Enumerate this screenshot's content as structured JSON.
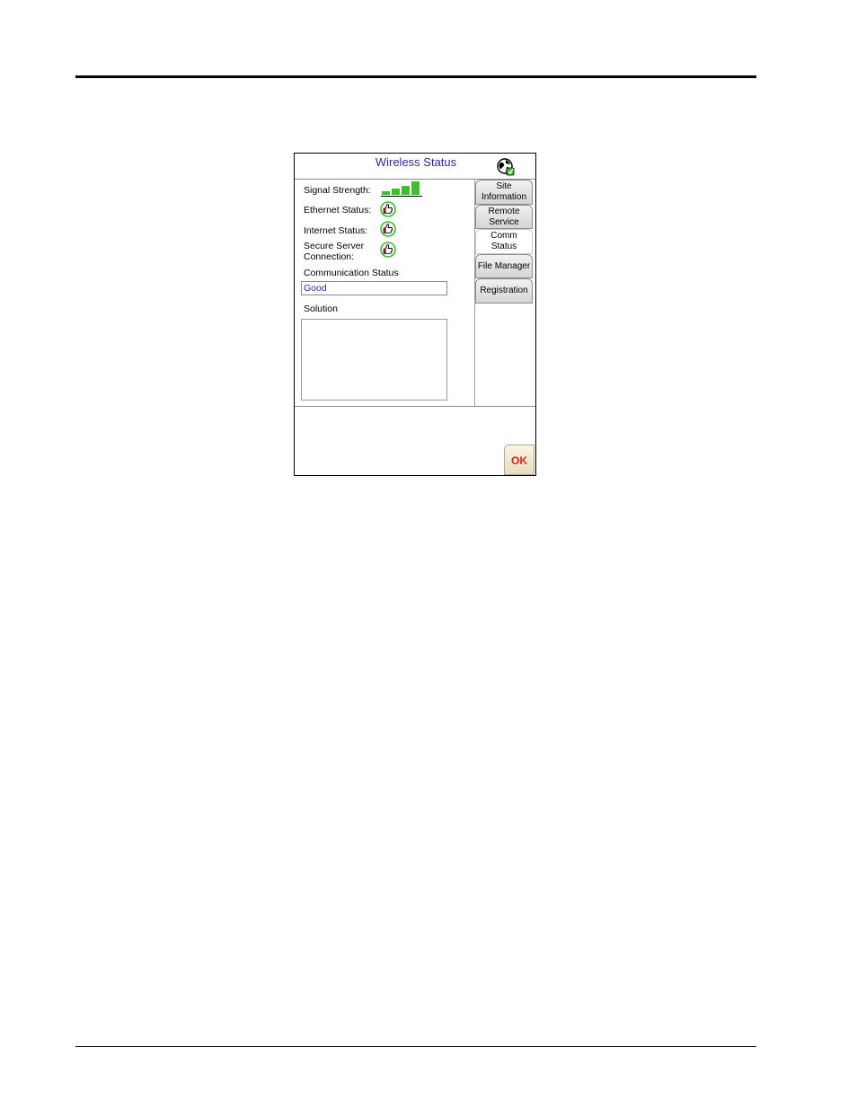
{
  "window": {
    "title": "Wireless Status"
  },
  "status": {
    "signal_label": "Signal Strength:",
    "signal_bars_active": 4,
    "signal_bars_total": 4,
    "ethernet_label": "Ethernet Status:",
    "internet_label": "Internet Status:",
    "secure_label_line1": "Secure Server",
    "secure_label_line2": "Connection:",
    "comm_status_label": "Communication Status",
    "comm_status_value": "Good",
    "solution_label": "Solution",
    "solution_value": ""
  },
  "tabs": [
    {
      "line1": "Site",
      "line2": "Information"
    },
    {
      "line1": "Remote",
      "line2": "Service"
    },
    {
      "line1": "Comm",
      "line2": "Status"
    },
    {
      "line1": "File Manager",
      "line2": ""
    },
    {
      "line1": "Registration",
      "line2": ""
    }
  ],
  "footer": {
    "ok_label": "OK"
  },
  "colors": {
    "signal_bar": "#3cbf2a",
    "title_text": "#2a2a9a",
    "ok_text": "#dd2222"
  }
}
